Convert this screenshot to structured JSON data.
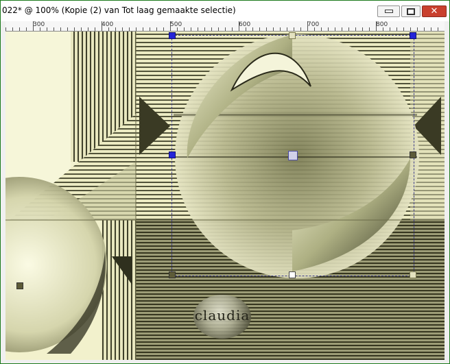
{
  "window": {
    "title": "022* @ 100% (Kopie (2) van Tot laag gemaakte selectie)"
  },
  "controls": {
    "close_glyph": "✕"
  },
  "ruler": {
    "labels": [
      "300",
      "400",
      "500",
      "600",
      "700",
      "800"
    ]
  },
  "watermark": {
    "text": "claudia"
  },
  "colors": {
    "window_border": "#1b7a1b",
    "close_button": "#c9402e",
    "canvas_cream": "#f2f2cf",
    "canvas_dark_olive": "#3a3a24",
    "selection_handle": "#2424d8"
  }
}
